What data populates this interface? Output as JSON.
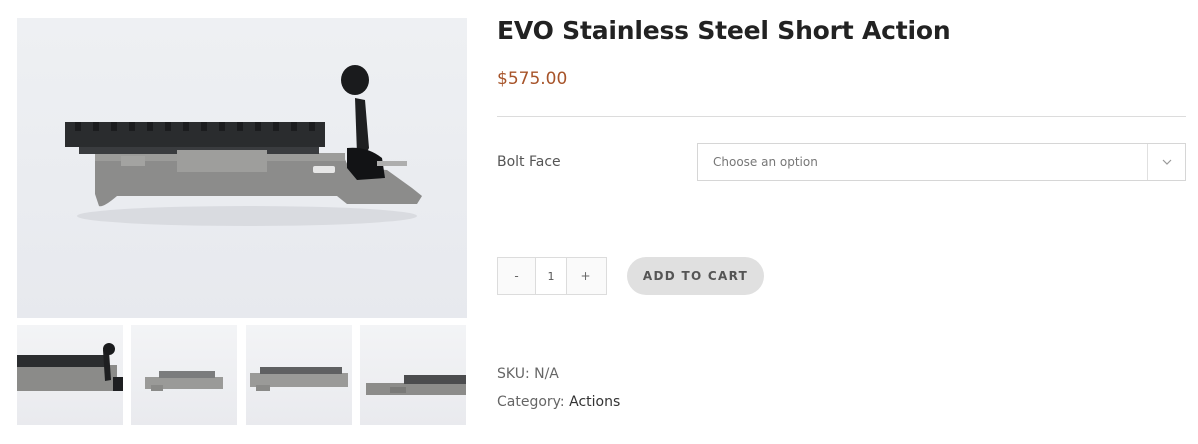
{
  "product": {
    "title": "EVO Stainless Steel Short Action",
    "price": "$575.00",
    "variation": {
      "label": "Bolt Face",
      "placeholder": "Choose an option"
    },
    "quantity": {
      "minus": "-",
      "value": "1",
      "plus": "+"
    },
    "add_to_cart": "ADD TO CART",
    "meta": {
      "sku_label": "SKU:",
      "sku_value": "N/A",
      "category_label": "Category:",
      "category_value": "Actions"
    }
  },
  "colors": {
    "price": "#a7542a",
    "button_bg": "#e0e0e0"
  },
  "icons": {
    "select_arrow": "chevron-down-icon"
  }
}
